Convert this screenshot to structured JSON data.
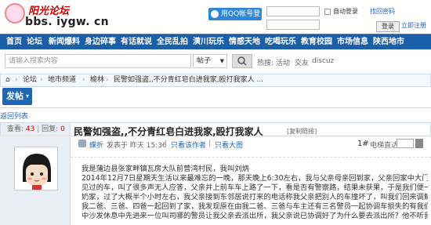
{
  "header": {
    "logo_text": "阳光论坛",
    "logo_url": "bbs. iygw. cn",
    "qq_login": "用QQ帐号登录",
    "remember": "自动登录",
    "find_password": "找回密码",
    "login": "登录",
    "register": "立即注册"
  },
  "nav": [
    "首页",
    "论坛",
    "新闻爆料",
    "身边碎事",
    "有话就说",
    "全民乱拍",
    "潢川玩乐",
    "情感天地",
    "吃喝玩乐",
    "教育校园",
    "市场信息",
    "陕西地市"
  ],
  "search": {
    "placeholder": "请输入搜索内容",
    "type": "帖子",
    "hot_label": "热搜:",
    "hot_items": [
      "活动",
      "交友",
      "discuz"
    ]
  },
  "breadcrumb": [
    "论坛",
    "地市频道",
    "榆林",
    "民警如强盗,,不分青红皂白进我家,殴打我家人 ..."
  ],
  "post_button": "发帖",
  "back_link": "返回列表",
  "stats": {
    "views_label": "查看:",
    "views": "43",
    "replies_label": "回复:",
    "replies": "0"
  },
  "thread": {
    "title": "民警如强盗,,不分青红皂白进我家,殴打我家人",
    "copy_link": "[复制链接]"
  },
  "meta": {
    "author": "蝶折",
    "posted": "发表于 昨天 15:36",
    "only_author": "只看该作者",
    "big_pic": "只看大图",
    "floor": "1#",
    "jump_label": "电梯直达"
  },
  "body": [
    "我是蒲边县张家畔镇瓦房大队前营湾村民，我叫刘炳",
    "2014年12月7日星期天生活以来最难忘的一晚，那天晚上6:30左右，我与父亲母亲回到家，父亲回家中大门口停放一辆从未",
    "见过的车，叫了很多声无人应答，父亲并上前车车上路了一下，看是否有警察路，结果未获果，于是我们便一起去了我奶",
    "奶家，过了大概半个小时左右，我父亲接到东邻居说打来的电话称我父亲把别人的车撞坏了，叫我们回来调解，我们便与",
    "我二爸、三爸、四爸一起回到了家，我发现原在由我二爸、三爸与车主还有三名警员一起协调车损失的有我们处理，我父亲在家",
    "中沙发休息中先进来一位叫司哪的警员让我父亲去派出所，我父亲说已协调好了为什么要去派出所？他不听我父亲解释，"
  ]
}
